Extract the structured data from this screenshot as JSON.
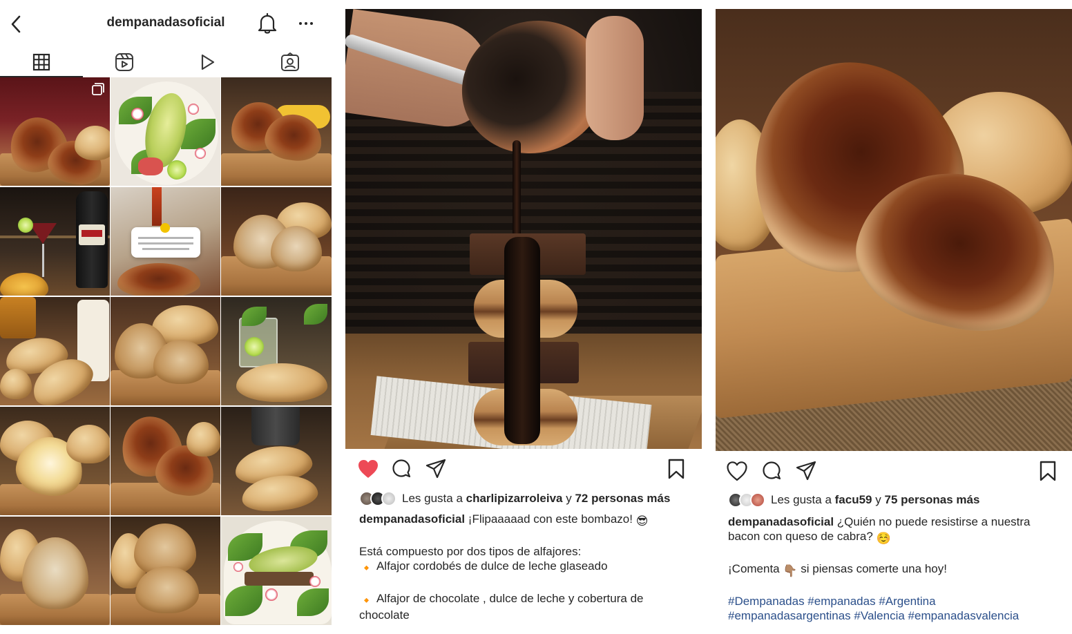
{
  "profile": {
    "username": "dempanadasoficial",
    "tabs": [
      {
        "icon": "grid-icon",
        "active": true
      },
      {
        "icon": "reels-icon",
        "active": false
      },
      {
        "icon": "video-play-icon",
        "active": false
      },
      {
        "icon": "tagged-icon",
        "active": false
      }
    ]
  },
  "post_middle": {
    "liked": true,
    "likes_prefix": "Les gusta a",
    "likes_user": "charlipizarroleiva",
    "likes_connector": "y",
    "likes_others": "72 personas más",
    "caption_user": "dempanadasoficial",
    "caption_text": "¡Flipaaaaad con este bombazo!",
    "caption_emoji": "😎",
    "line2": "Está compuesto por dos tipos de alfajores:",
    "line3": "Alfajor cordobés de dulce de leche glaseado",
    "line4": "Alfajor de chocolate , dulce de leche y cobertura de chocolate",
    "bullet": "🔸"
  },
  "post_right": {
    "liked": false,
    "likes_prefix": "Les gusta a",
    "likes_user": "facu59",
    "likes_connector": "y",
    "likes_others": "75 personas más",
    "caption_user": "dempanadasoficial",
    "caption_text": "¿Quién no puede resistirse a nuestra bacon con queso de cabra?",
    "caption_emoji": "☺️",
    "line2_a": "¡Comenta",
    "line2_emoji": "👇🏽",
    "line2_b": "si piensas comerte una hoy!",
    "hashtags_line1": "#Dempanadas #empanadas #Argentina",
    "hashtags_line2": "#empanadasargentinas #Valencia #empanadasvalencia"
  },
  "colors": {
    "text": "#262626",
    "like_red": "#ed4956",
    "hashtag_blue": "#2b4f8a"
  }
}
